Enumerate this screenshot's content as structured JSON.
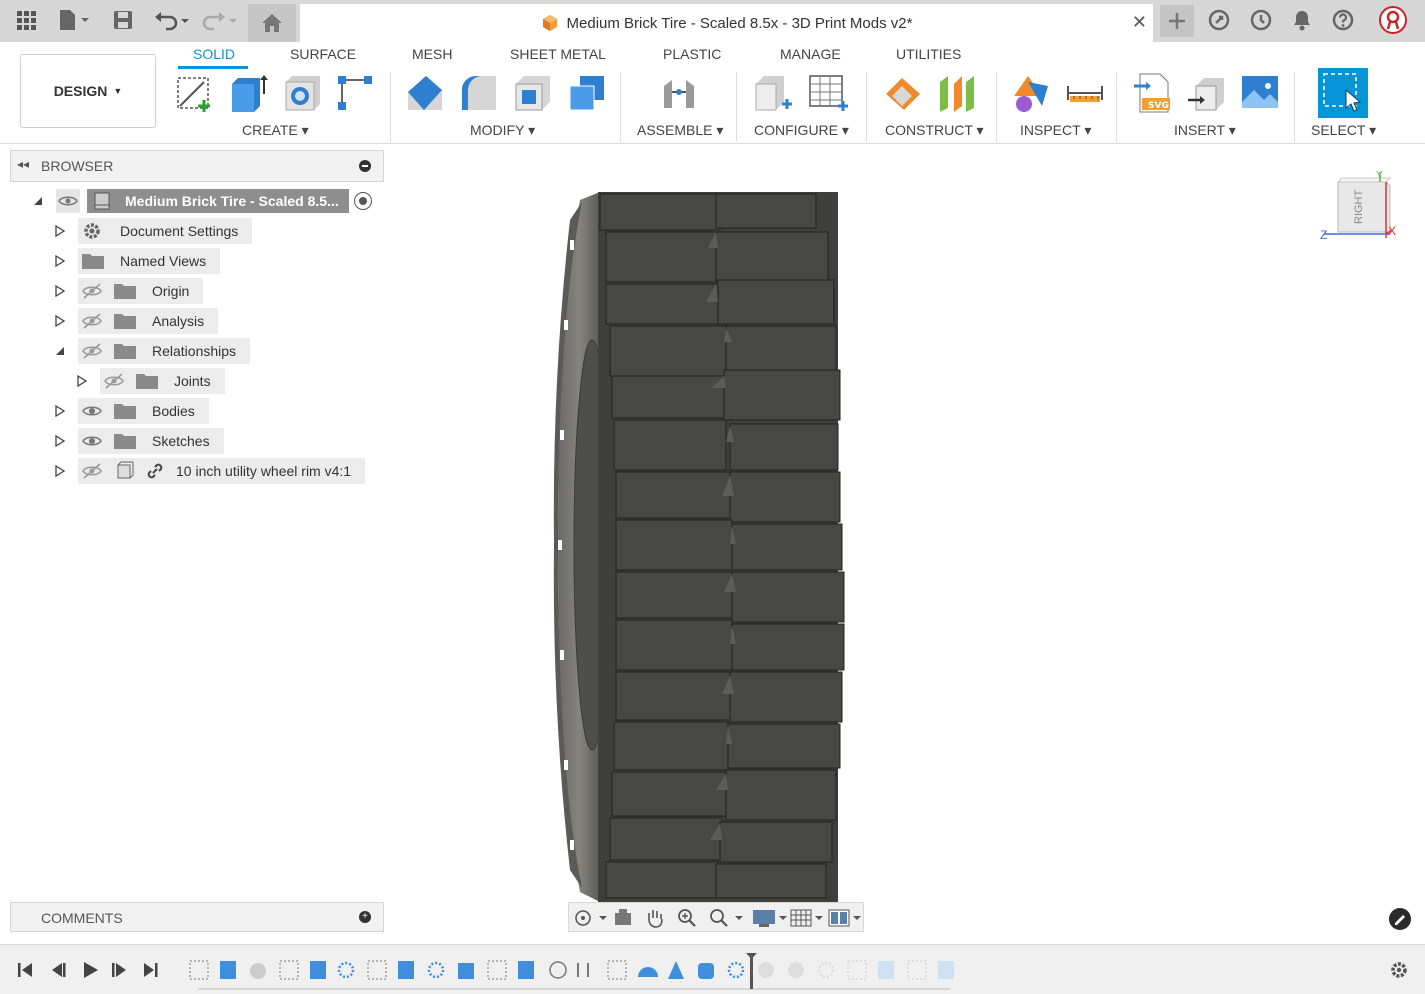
{
  "titlebar": {
    "document_title": "Medium Brick Tire - Scaled 8.5x - 3D Print Mods v2*",
    "icons": [
      "grid-icon",
      "file-icon",
      "save-icon",
      "undo-icon",
      "redo-icon",
      "home-icon",
      "close-icon",
      "plus-icon",
      "extensions-icon",
      "clock-icon",
      "bell-icon",
      "help-icon",
      "user-avatar"
    ]
  },
  "toolbar": {
    "design_label": "DESIGN",
    "tabs": [
      "SOLID",
      "SURFACE",
      "MESH",
      "SHEET METAL",
      "PLASTIC",
      "MANAGE",
      "UTILITIES"
    ],
    "groups": [
      "CREATE",
      "MODIFY",
      "ASSEMBLE",
      "CONFIGURE",
      "CONSTRUCT",
      "INSPECT",
      "INSERT",
      "SELECT"
    ],
    "accent": "#0696d7"
  },
  "browser": {
    "header": "BROWSER",
    "root": "Medium Brick Tire - Scaled 8.5...",
    "items": [
      {
        "label": "Document Settings"
      },
      {
        "label": "Named Views"
      },
      {
        "label": "Origin"
      },
      {
        "label": "Analysis"
      },
      {
        "label": "Relationships"
      },
      {
        "label": "Joints"
      },
      {
        "label": "Bodies"
      },
      {
        "label": "Sketches"
      },
      {
        "label": "10 inch utility wheel rim v4:1"
      }
    ]
  },
  "comments": {
    "header": "COMMENTS"
  },
  "viewcube": {
    "face": "RIGHT",
    "axis_z": "Z",
    "axis_x": "X",
    "axis_y": "Y"
  }
}
